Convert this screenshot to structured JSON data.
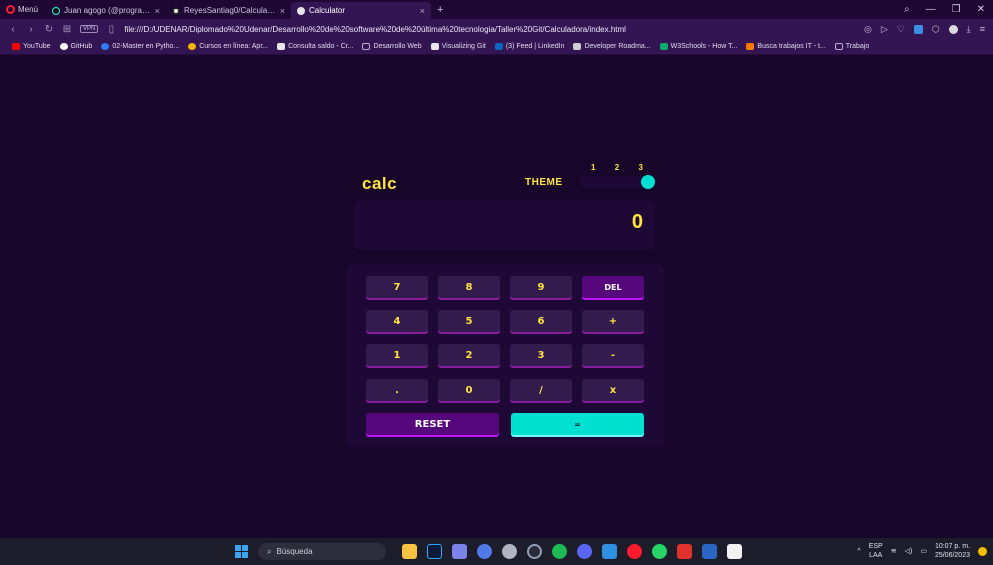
{
  "browser": {
    "menu_label": "Menú",
    "tabs": [
      {
        "title": "Juan agogo (@programador",
        "icon": "tiktok-icon"
      },
      {
        "title": "ReyesSantiag0/Calculadora",
        "icon": "github-icon"
      },
      {
        "title": "Calculator",
        "icon": "page-icon",
        "active": true
      }
    ],
    "new_tab": "+",
    "url": "file:///D:/UDENAR/Diplomado%20Udenar/Desarrollo%20de%20software%20de%20última%20tecnologia/Taller%20Git/Calculadora/index.html",
    "vpn_label": "VPN",
    "bookmarks": [
      {
        "label": "YouTube",
        "color": "#ff0000"
      },
      {
        "label": "GitHub",
        "color": "#ffffff"
      },
      {
        "label": "02-Master en Pytho...",
        "color": "#2e7cf6"
      },
      {
        "label": "Cursos en línea: Apr...",
        "color": "#f5b400"
      },
      {
        "label": "Consulta saldo - Cr...",
        "color": "#e8e8e8"
      },
      {
        "label": "Desarrollo Web",
        "color": "#8f86a0"
      },
      {
        "label": "Visualizing Git",
        "color": "#e8e8e8"
      },
      {
        "label": "(3) Feed | LinkedIn",
        "color": "#0a66c2"
      },
      {
        "label": "Developer Roadma...",
        "color": "#cfcfcf"
      },
      {
        "label": "W3Schools - How T...",
        "color": "#04aa6d"
      },
      {
        "label": "Busca trabajos IT - t...",
        "color": "#ff7a00"
      },
      {
        "label": "Trabajo",
        "color": "#8f86a0"
      }
    ]
  },
  "calculator": {
    "logo": "calc",
    "theme_label": "THEME",
    "theme_options": [
      "1",
      "2",
      "3"
    ],
    "active_theme": 3,
    "display_value": "0",
    "keys": {
      "k7": "7",
      "k8": "8",
      "k9": "9",
      "del": "DEL",
      "k4": "4",
      "k5": "5",
      "k6": "6",
      "plus": "+",
      "k1": "1",
      "k2": "2",
      "k3": "3",
      "minus": "-",
      "dot": ".",
      "k0": "0",
      "divide": "/",
      "multiply": "x",
      "reset": "RESET",
      "equals": "="
    },
    "colors": {
      "background": "#17062a",
      "accent_text": "#ffe53d",
      "equals_key": "#00e0d1",
      "function_key": "#56077c"
    }
  },
  "taskbar": {
    "search_placeholder": "Búsqueda",
    "language": "ESP",
    "layout": "LAA",
    "time": "10:07 p. m.",
    "date": "25/06/2023"
  }
}
